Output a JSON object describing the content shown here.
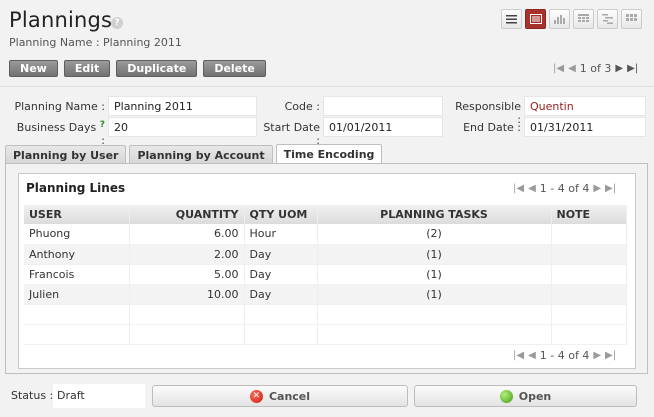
{
  "header": {
    "title": "Plannings",
    "help": "?",
    "subtitle": "Planning Name : Planning 2011"
  },
  "view_icons": [
    "list-view-icon",
    "form-view-icon",
    "graph-view-icon",
    "calendar-view-icon",
    "gantt-view-icon",
    "grid-view-icon"
  ],
  "toolbar": {
    "new_label": "New",
    "edit_label": "Edit",
    "duplicate_label": "Duplicate",
    "delete_label": "Delete"
  },
  "pager": {
    "text": "1 of 3"
  },
  "form": {
    "planning_name_label": "Planning Name :",
    "planning_name": "Planning 2011",
    "code_label": "Code :",
    "code": "",
    "responsible_label": "Responsible :",
    "responsible": "Quentin",
    "business_days_label": "Business Days",
    "business_days_help": "?",
    "business_days_colon": ":",
    "business_days": "20",
    "start_date_label": "Start Date :",
    "start_date": "01/01/2011",
    "end_date_label": "End Date :",
    "end_date": "01/31/2011"
  },
  "tabs": [
    {
      "label": "Planning by User"
    },
    {
      "label": "Planning by Account"
    },
    {
      "label": "Time Encoding"
    }
  ],
  "lines": {
    "title": "Planning Lines",
    "pager_text": "1 - 4 of 4",
    "columns": [
      "USER",
      "QUANTITY",
      "QTY UOM",
      "PLANNING TASKS",
      "NOTE"
    ],
    "rows": [
      {
        "user": "Phuong",
        "quantity": "6.00",
        "uom": "Hour",
        "tasks": "(2)",
        "note": ""
      },
      {
        "user": "Anthony",
        "quantity": "2.00",
        "uom": "Day",
        "tasks": "(1)",
        "note": ""
      },
      {
        "user": "Francois",
        "quantity": "5.00",
        "uom": "Day",
        "tasks": "(1)",
        "note": ""
      },
      {
        "user": "Julien",
        "quantity": "10.00",
        "uom": "Day",
        "tasks": "(1)",
        "note": ""
      }
    ]
  },
  "footer": {
    "status_label": "Status :",
    "status": "Draft",
    "cancel_label": "Cancel",
    "open_label": "Open"
  },
  "colors": {
    "accent": "#a9312b",
    "responsible_text": "#9a1a1a"
  }
}
